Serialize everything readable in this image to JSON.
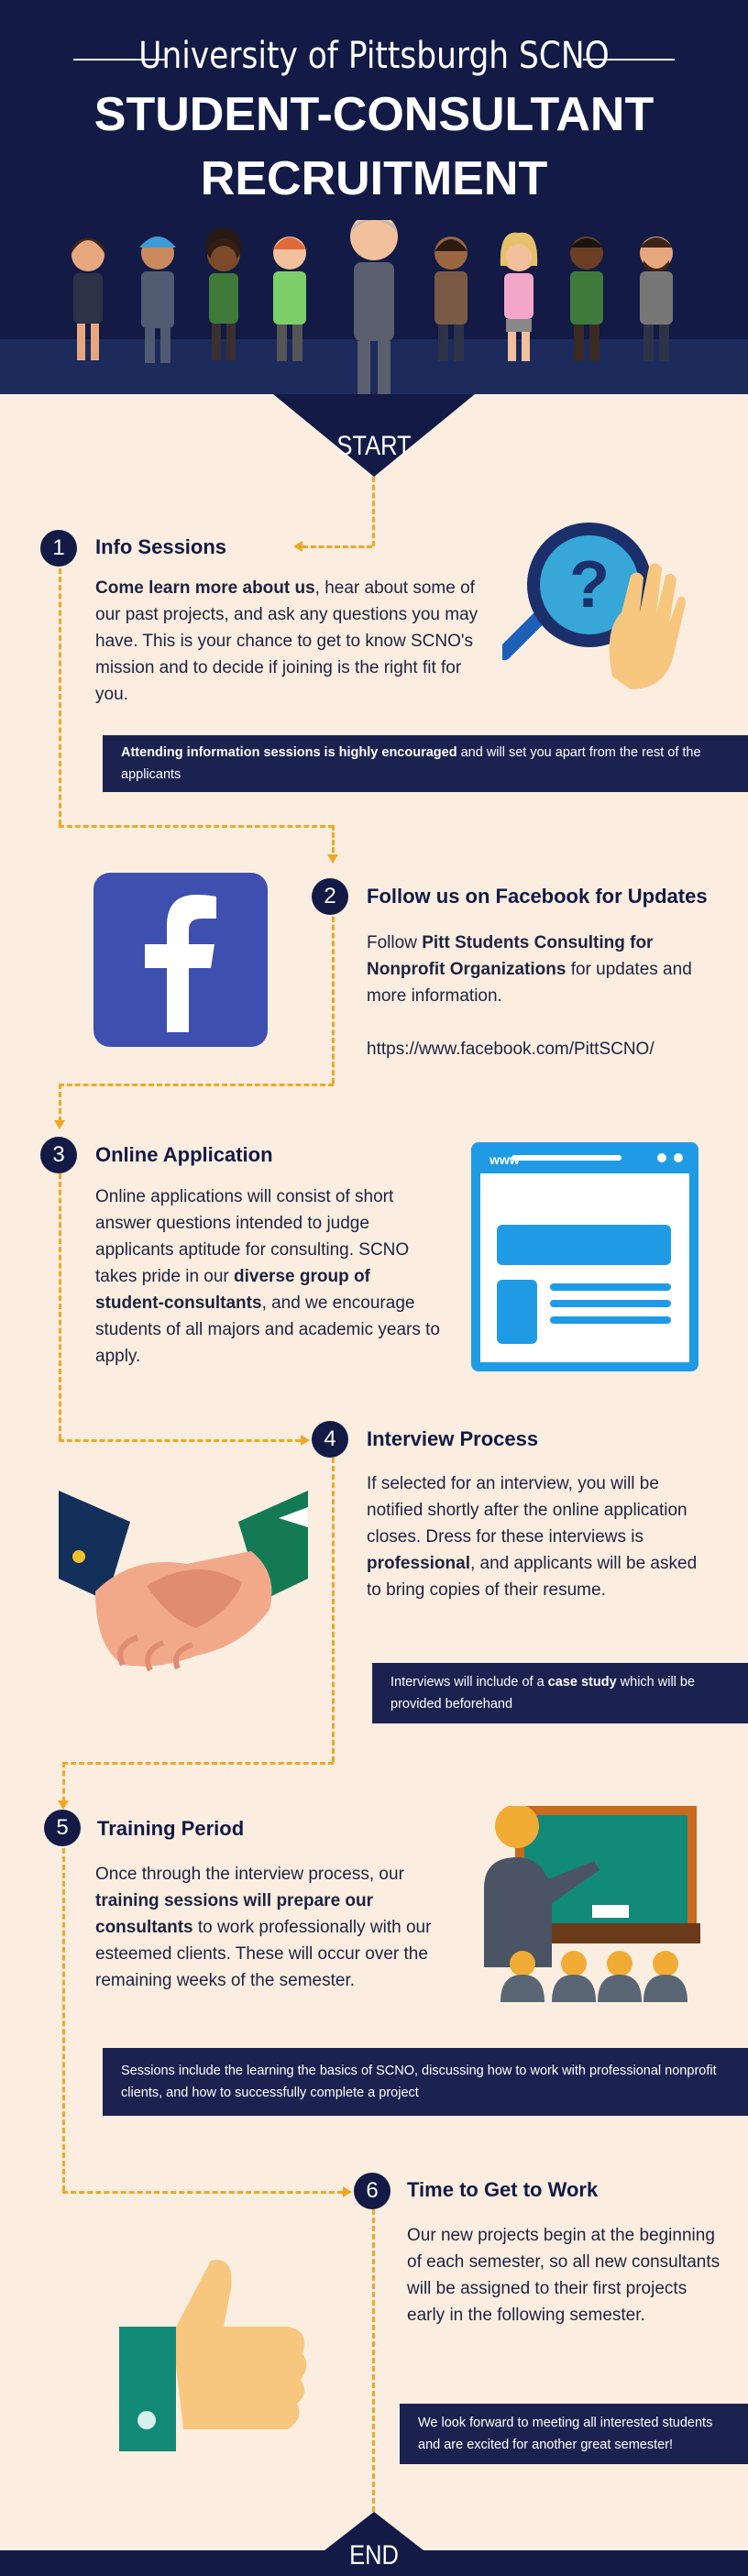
{
  "header": {
    "university": "University of Pittsburgh SCNO",
    "title_line1": "STUDENT-CONSULTANT",
    "title_line2": "RECRUITMENT"
  },
  "flow": {
    "start": "START",
    "end": "END"
  },
  "steps": [
    {
      "number": "1",
      "title": "Info Sessions",
      "body_bold": "Come learn more about us",
      "body_rest": ", hear about some of our past projects, and ask any questions you may have. This is your chance to get to know SCNO's mission and to decide if joining is the right fit for you.",
      "note_bold": "Attending information sessions is highly encouraged",
      "note_rest": " and will set you apart from the rest of the applicants",
      "icon": "magnifier-question-icon"
    },
    {
      "number": "2",
      "title": "Follow us on Facebook for Updates",
      "body_pre": "Follow ",
      "body_bold": "Pitt Students Consulting for Nonprofit Organizations",
      "body_rest": " for updates and more information.",
      "link": "https://www.facebook.com/PittSCNO/",
      "icon": "facebook-icon"
    },
    {
      "number": "3",
      "title": "Online Application",
      "body_pre": "Online applications will consist of short answer questions intended to judge applicants aptitude for consulting. SCNO takes pride in our ",
      "body_bold": "diverse group of student-consultants",
      "body_rest": ", and we encourage students of all majors and academic years to apply.",
      "icon": "browser-window-icon",
      "icon_url_text": "www"
    },
    {
      "number": "4",
      "title": "Interview Process",
      "body_pre": "If selected for an interview, you will be notified shortly after the online application closes. Dress for these interviews is ",
      "body_bold": "professional",
      "body_rest": ", and applicants will be asked to bring copies of their resume.",
      "note_pre": "Interviews will include of a ",
      "note_bold": "case study",
      "note_rest": " which will be provided beforehand",
      "icon": "handshake-icon"
    },
    {
      "number": "5",
      "title": "Training Period",
      "body_pre": "Once through the interview process, our ",
      "body_bold": "training sessions will prepare our consultants",
      "body_rest": " to work professionally with our esteemed clients. These will occur over the remaining weeks of the semester.",
      "note": "Sessions include the learning the basics of SCNO, discussing how to work with professional nonprofit clients, and how to successfully complete a project",
      "icon": "teacher-board-icon"
    },
    {
      "number": "6",
      "title": "Time to Get to Work",
      "body": "Our new projects begin at the beginning of each semester, so all new consultants will be assigned to their first projects early in the following semester.",
      "note": "We look forward to meeting all interested students and are excited for another great semester!",
      "icon": "thumbs-up-icon"
    }
  ],
  "colors": {
    "navy": "#121a45",
    "cream": "#fbeee0",
    "accent_dash": "#f0a726",
    "facebook_blue": "#3f4fb0",
    "browser_blue": "#1f9be6"
  }
}
